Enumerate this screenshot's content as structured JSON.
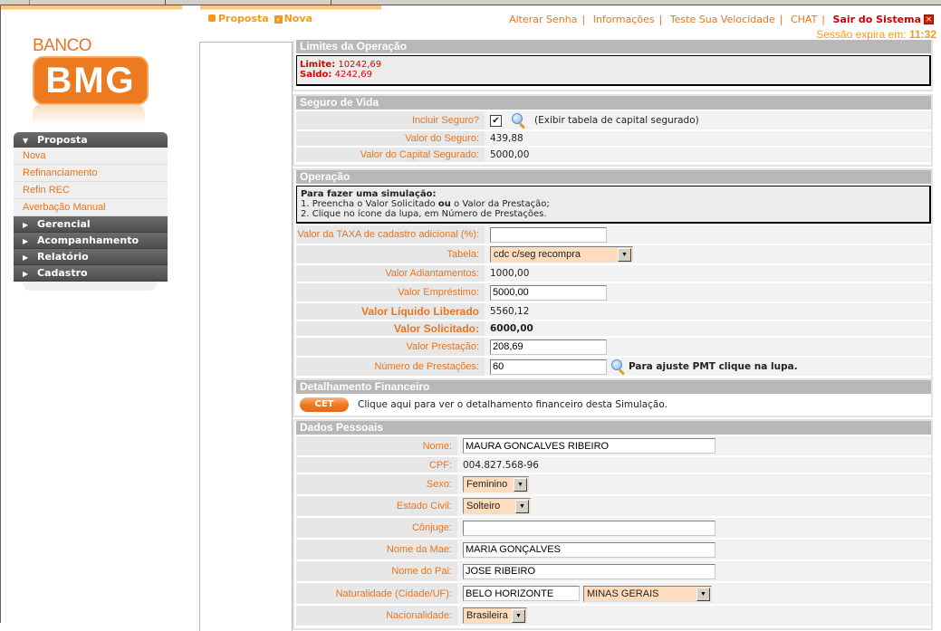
{
  "breadcrumb": {
    "root": "Proposta",
    "current": "Nova"
  },
  "logo": {
    "line1": "BANCO",
    "line2": "BMG"
  },
  "top_links": [
    {
      "label": "Alterar Senha"
    },
    {
      "label": "Informações"
    },
    {
      "label": "Teste Sua Velocidade"
    },
    {
      "label": "CHAT"
    }
  ],
  "logout_label": "Sair do Sistema",
  "session": {
    "prefix": "Sessão expira em:",
    "time": "11:32"
  },
  "sidebar": {
    "open_section": "Proposta",
    "sub_items": [
      "Nova",
      "Refinanciamento",
      "Refin REC",
      "Averbação Manual"
    ],
    "sections": [
      "Gerencial",
      "Acompanhamento",
      "Relatório",
      "Cadastro"
    ]
  },
  "limites": {
    "title": "Limites da Operação",
    "limite_label": "Limite:",
    "limite_value": "10242,69",
    "saldo_label": "Saldo:",
    "saldo_value": "4242,69"
  },
  "seguro": {
    "title": "Seguro de Vida",
    "incluir_label": "Incluir Seguro?",
    "incluir_checked": true,
    "tabela_link": "(Exibir tabela de capital segurado)",
    "valor_seguro_label": "Valor do Seguro:",
    "valor_seguro": "439,88",
    "capital_label": "Valor do Capital Segurado:",
    "capital": "5000,00"
  },
  "operacao": {
    "title": "Operação",
    "notice_title": "Para fazer uma simulação:",
    "notice_1_a": "1. Preencha o Valor Solicitado ",
    "notice_1_b": "ou",
    "notice_1_c": " o Valor da Prestação;",
    "notice_2": "2. Clique no ícone da lupa, em Número de Prestações.",
    "taxa_label": "Valor da TAXA de cadastro adicional (%):",
    "taxa_value": "",
    "tabela_label": "Tabela:",
    "tabela_value": "cdc c/seg recompra",
    "adiant_label": "Valor Adiantamentos:",
    "adiant_value": "1000,00",
    "emprestimo_label": "Valor Empréstimo:",
    "emprestimo_value": "5000,00",
    "liquido_label": "Valor Líquido Liberado",
    "liquido_value": "5560,12",
    "solicitado_label": "Valor Solicitado:",
    "solicitado_value": "6000,00",
    "prestacao_label": "Valor Prestação:",
    "prestacao_value": "208,69",
    "num_prest_label": "Número de Prestações:",
    "num_prest_value": "60",
    "pmt_hint": "Para ajuste PMT clique na lupa."
  },
  "detalhamento": {
    "title": "Detalhamento Financeiro",
    "button": "CET",
    "text": "Clique aqui para ver o detalhamento financeiro desta Simulação."
  },
  "pessoais": {
    "title": "Dados Pessoais",
    "nome_label": "Nome:",
    "nome": "MAURA GONCALVES RIBEIRO",
    "cpf_label": "CPF:",
    "cpf": "004.827.568-96",
    "sexo_label": "Sexo:",
    "sexo": "Feminino",
    "civil_label": "Estado Civil:",
    "civil": "Solteiro",
    "conjuge_label": "Cônjuge:",
    "conjuge": "",
    "mae_label": "Nome da Mae:",
    "mae": "MARIA GONÇALVES",
    "pai_label": "Nome do Pai:",
    "pai": "JOSE RIBEIRO",
    "natural_label": "Naturalidade (Cidade/UF):",
    "natural_cidade": "BELO HORIZONTE",
    "natural_uf": "MINAS GERAIS",
    "nacional_label": "Nacionalidade:",
    "nacional": "Brasileira"
  }
}
